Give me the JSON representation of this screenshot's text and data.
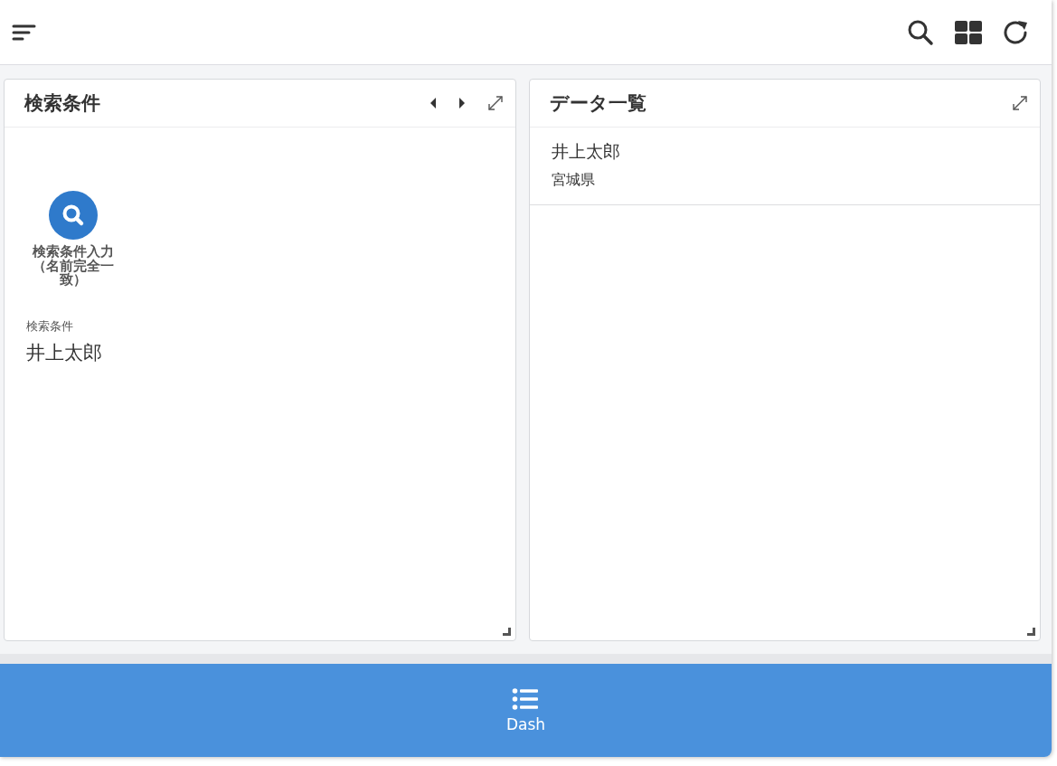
{
  "panels": [
    {
      "kind": "search",
      "title": "検索条件",
      "has_pager": true,
      "launcher": {
        "label": "検索条件入力（名前完全一致）"
      },
      "field": {
        "label": "検索条件",
        "value": "井上太郎"
      }
    },
    {
      "kind": "list",
      "title": "データ一覧",
      "has_pager": false,
      "rows": [
        {
          "name": "井上太郎",
          "prefecture": "宮城県"
        }
      ]
    }
  ],
  "bottom_nav": [
    {
      "label": "Dash"
    }
  ]
}
